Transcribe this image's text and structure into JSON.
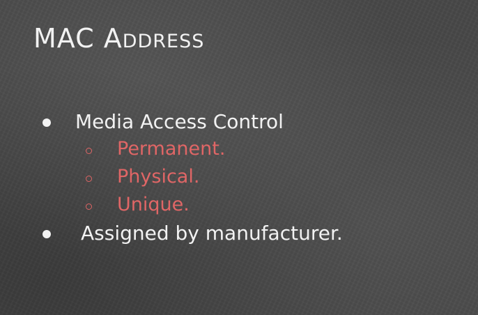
{
  "slide": {
    "title": "MAC Address",
    "bullets": [
      {
        "text": "Media Access Control",
        "sub_items": [
          "Permanent.",
          "Physical.",
          "Unique."
        ]
      },
      {
        "text": "Assigned by manufacturer."
      }
    ]
  },
  "colors": {
    "background": "#474747",
    "primary_text": "#f2f2f2",
    "accent_text": "#e06666"
  }
}
